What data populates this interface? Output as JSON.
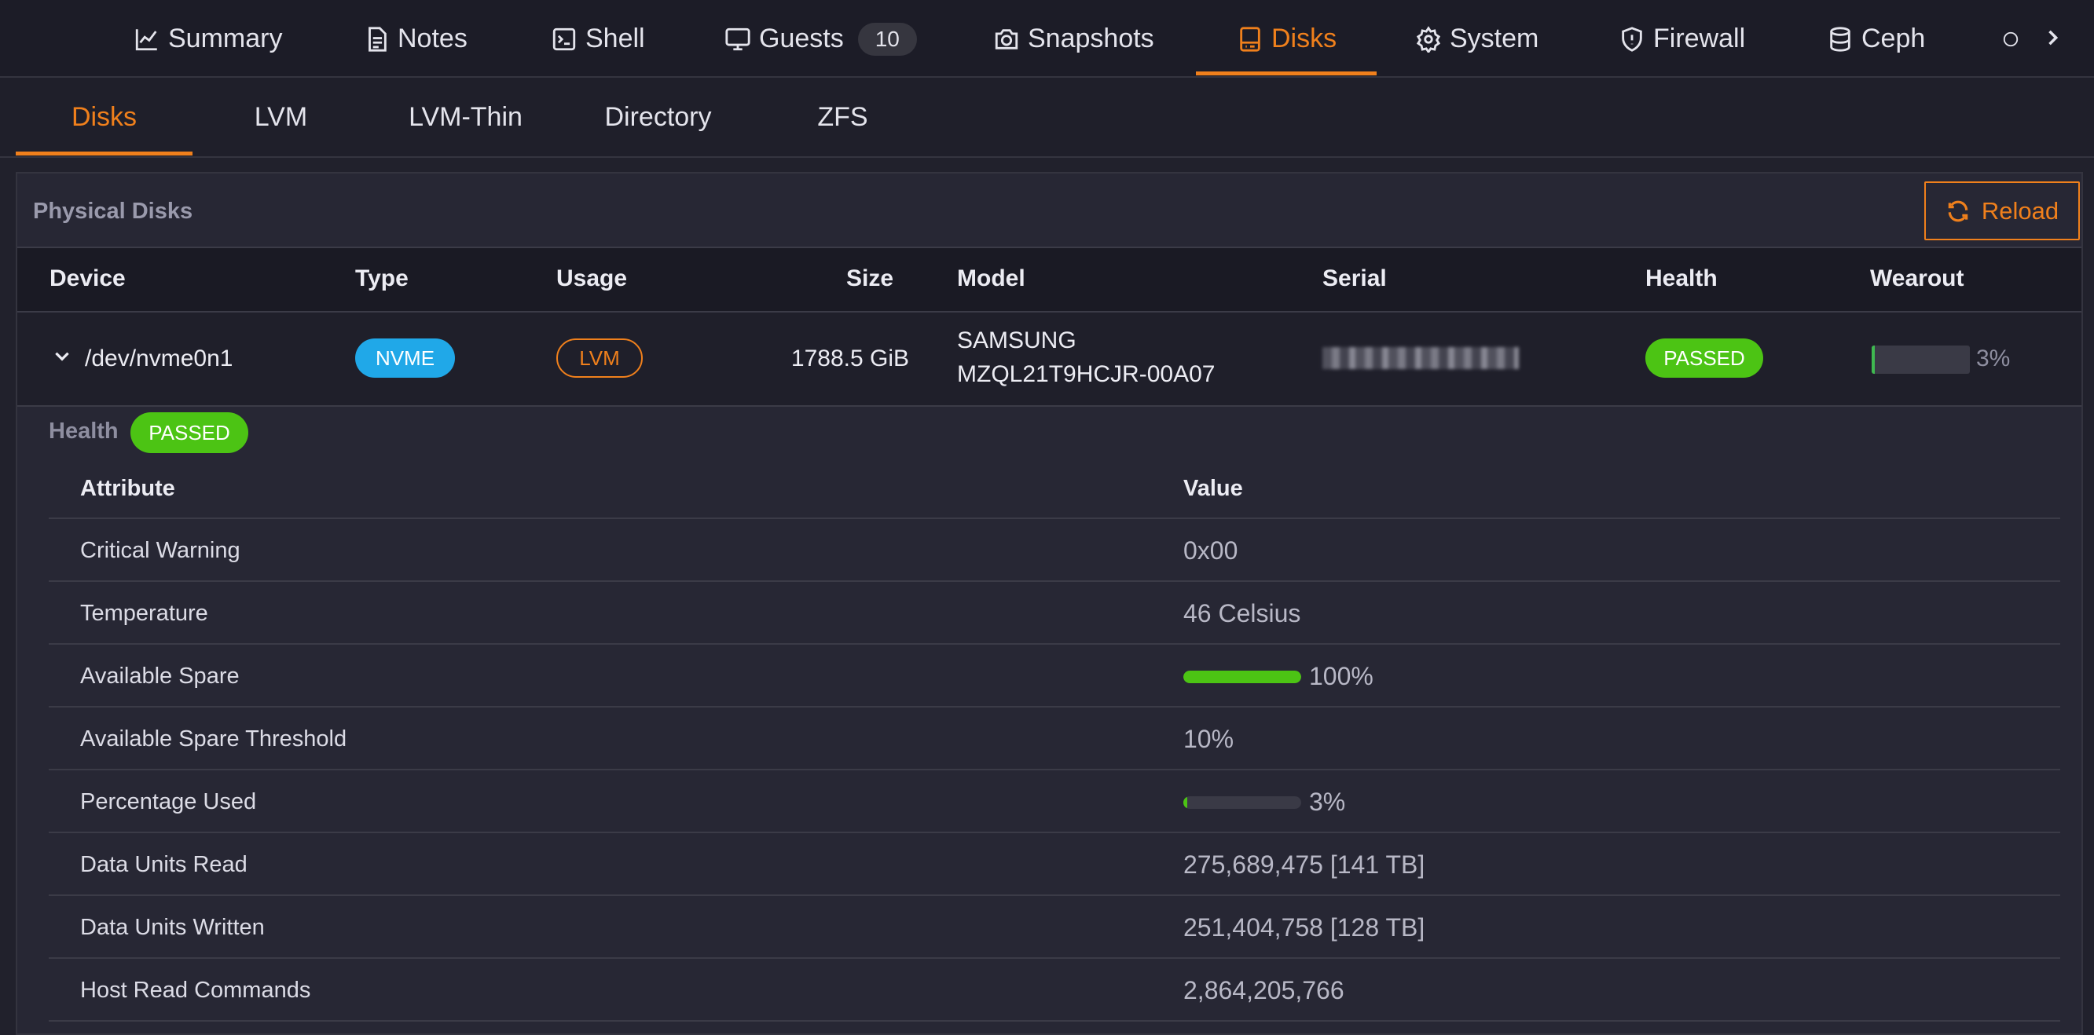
{
  "topnav": {
    "tabs": [
      {
        "label": "Summary",
        "icon": "chart-line-icon"
      },
      {
        "label": "Notes",
        "icon": "document-icon"
      },
      {
        "label": "Shell",
        "icon": "terminal-icon"
      },
      {
        "label": "Guests",
        "icon": "monitor-icon",
        "count": "10"
      },
      {
        "label": "Snapshots",
        "icon": "camera-icon"
      },
      {
        "label": "Disks",
        "icon": "hard-drive-icon",
        "active": true
      },
      {
        "label": "System",
        "icon": "gear-icon"
      },
      {
        "label": "Firewall",
        "icon": "shield-icon"
      },
      {
        "label": "Ceph",
        "icon": "database-icon"
      }
    ]
  },
  "subnav": {
    "tabs": [
      "Disks",
      "LVM",
      "LVM-Thin",
      "Directory",
      "ZFS"
    ],
    "active": "Disks"
  },
  "panel": {
    "title": "Physical Disks",
    "reload_label": "Reload"
  },
  "disks_table": {
    "columns": [
      "Device",
      "Type",
      "Usage",
      "Size",
      "Model",
      "Serial",
      "Health",
      "Wearout"
    ],
    "rows": [
      {
        "device": "/dev/nvme0n1",
        "type": "NVME",
        "usage": "LVM",
        "size": "1788.5 GiB",
        "model_line1": "SAMSUNG",
        "model_line2": "MZQL21T9HCJR-00A07",
        "serial": "",
        "health": "PASSED",
        "wearout": "3%",
        "wearout_fraction": 0.03
      }
    ]
  },
  "health_detail": {
    "label": "Health",
    "status": "PASSED",
    "columns": [
      "Attribute",
      "Value"
    ],
    "rows": [
      {
        "attribute": "Critical Warning",
        "value": "0x00"
      },
      {
        "attribute": "Temperature",
        "value": "46 Celsius"
      },
      {
        "attribute": "Available Spare",
        "value": "100%",
        "bar_fraction": 1.0
      },
      {
        "attribute": "Available Spare Threshold",
        "value": "10%"
      },
      {
        "attribute": "Percentage Used",
        "value": "3%",
        "bar_fraction": 0.03
      },
      {
        "attribute": "Data Units Read",
        "value": "275,689,475 [141 TB]"
      },
      {
        "attribute": "Data Units Written",
        "value": "251,404,758 [128 TB]"
      },
      {
        "attribute": "Host Read Commands",
        "value": "2,864,205,766"
      }
    ]
  },
  "colors": {
    "accent": "#f0801c",
    "passed": "#4cc414",
    "nvme": "#20a8e8"
  }
}
